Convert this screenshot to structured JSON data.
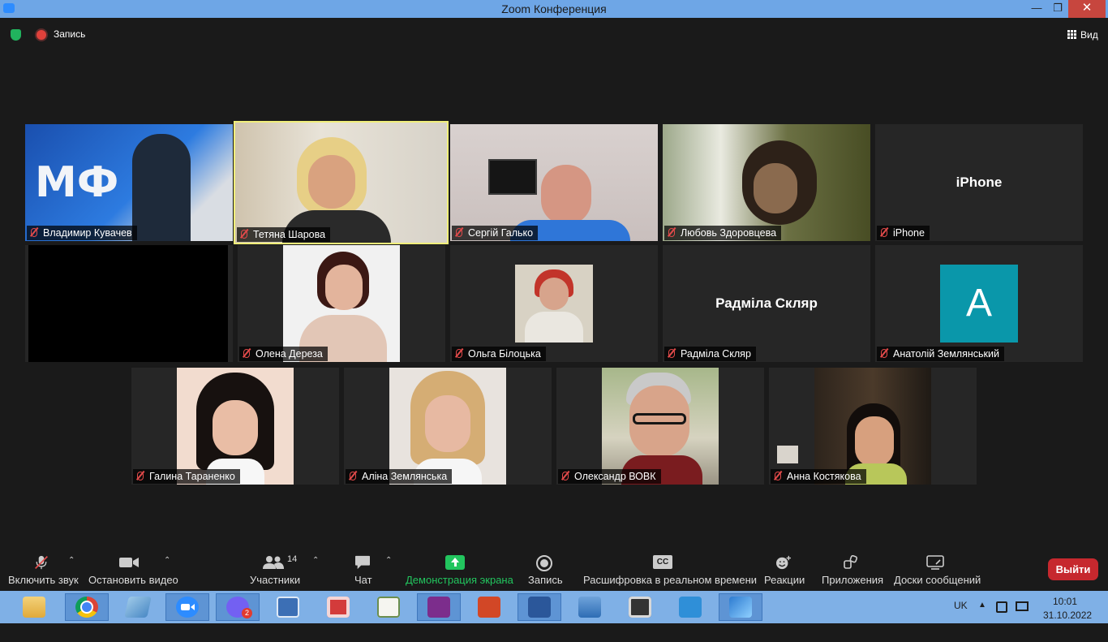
{
  "window": {
    "title": "Zoom Конференция"
  },
  "topbar": {
    "record_label": "Запись",
    "view_label": "Вид"
  },
  "participants": [
    {
      "name": "Владимир Кувачев"
    },
    {
      "name": "Тетяна Шарова"
    },
    {
      "name": "Сергій Галько"
    },
    {
      "name": "Любовь Здоровцева"
    },
    {
      "name": "iPhone",
      "big_name": "iPhone"
    },
    {
      "name": ""
    },
    {
      "name": "Олена Дереза"
    },
    {
      "name": "Ольга Білоцька"
    },
    {
      "name": "Радміла Скляр",
      "big_name": "Радміла Скляр"
    },
    {
      "name": "Анатолій Землянський",
      "avatar_letter": "A"
    },
    {
      "name": "Галина Тараненко"
    },
    {
      "name": "Аліна Землянська"
    },
    {
      "name": "Олександр ВОВК"
    },
    {
      "name": "Анна Костякова"
    }
  ],
  "toolbar": {
    "audio_label": "Включить звук",
    "video_label": "Остановить видео",
    "participants_label": "Участники",
    "participants_count": "14",
    "chat_label": "Чат",
    "share_label": "Демонстрация экрана",
    "record_label": "Запись",
    "captions_label": "Расшифровка в реальном времени",
    "reactions_label": "Реакции",
    "apps_label": "Приложения",
    "whiteboard_label": "Доски сообщений",
    "leave_label": "Выйти",
    "share_color": "#22c55e",
    "leave_color": "#c6282e"
  },
  "taskbar": {
    "apps": [
      "file-explorer-icon",
      "chrome-icon",
      "notepad-icon",
      "zoom-icon",
      "viber-icon",
      "lenovo-icon",
      "pdf-editor-icon",
      "document-viewer-icon",
      "foxit-pdf-icon",
      "powerpoint-icon",
      "word-icon",
      "network-icon",
      "media-player-icon",
      "video-call-icon",
      "feather-app-icon"
    ],
    "viber_badge": "2",
    "lang": "UK",
    "time": "10:01",
    "date": "31.10.2022"
  }
}
